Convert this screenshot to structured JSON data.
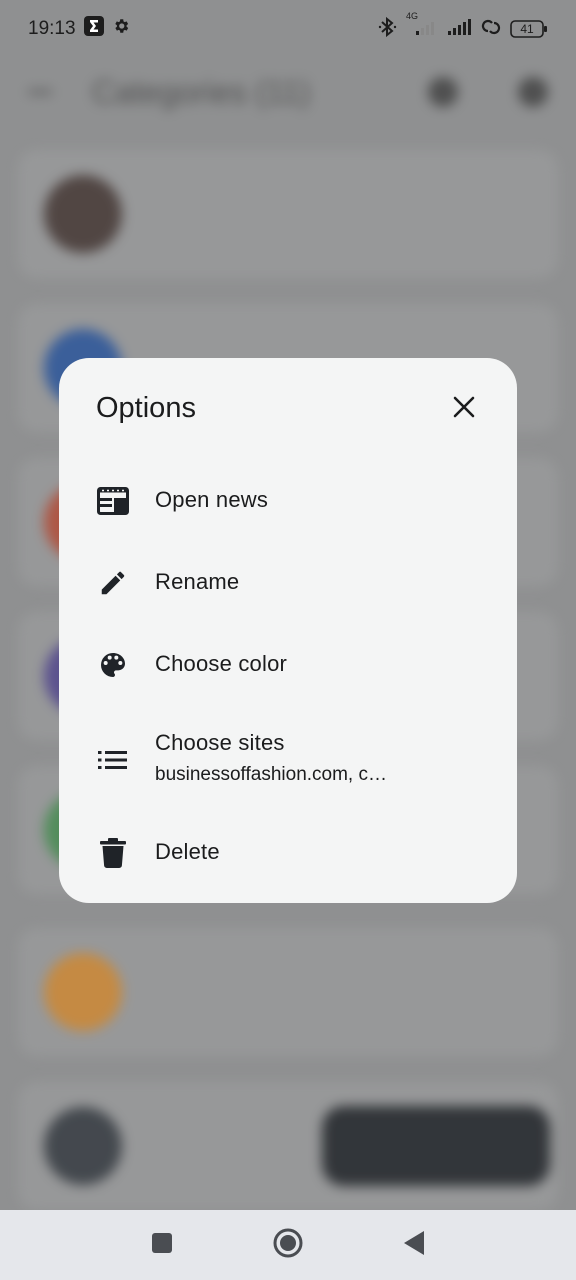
{
  "status_bar": {
    "time": "19:13",
    "network": "4G",
    "battery": "41"
  },
  "background": {
    "title": "Categories (11)"
  },
  "dialog": {
    "title": "Options",
    "options": [
      {
        "label": "Open news",
        "icon": "newspaper-icon"
      },
      {
        "label": "Rename",
        "icon": "pencil-icon"
      },
      {
        "label": "Choose color",
        "icon": "palette-icon"
      },
      {
        "label": "Choose sites",
        "sublabel": "businessoffashion.com, c…",
        "icon": "list-icon"
      },
      {
        "label": "Delete",
        "icon": "trash-icon"
      }
    ]
  },
  "colors": {
    "dialog_bg": "#f4f5f5",
    "scrim": "#8f9091",
    "icon": "#1f2328",
    "nav_bar": "#e5e7eb"
  }
}
